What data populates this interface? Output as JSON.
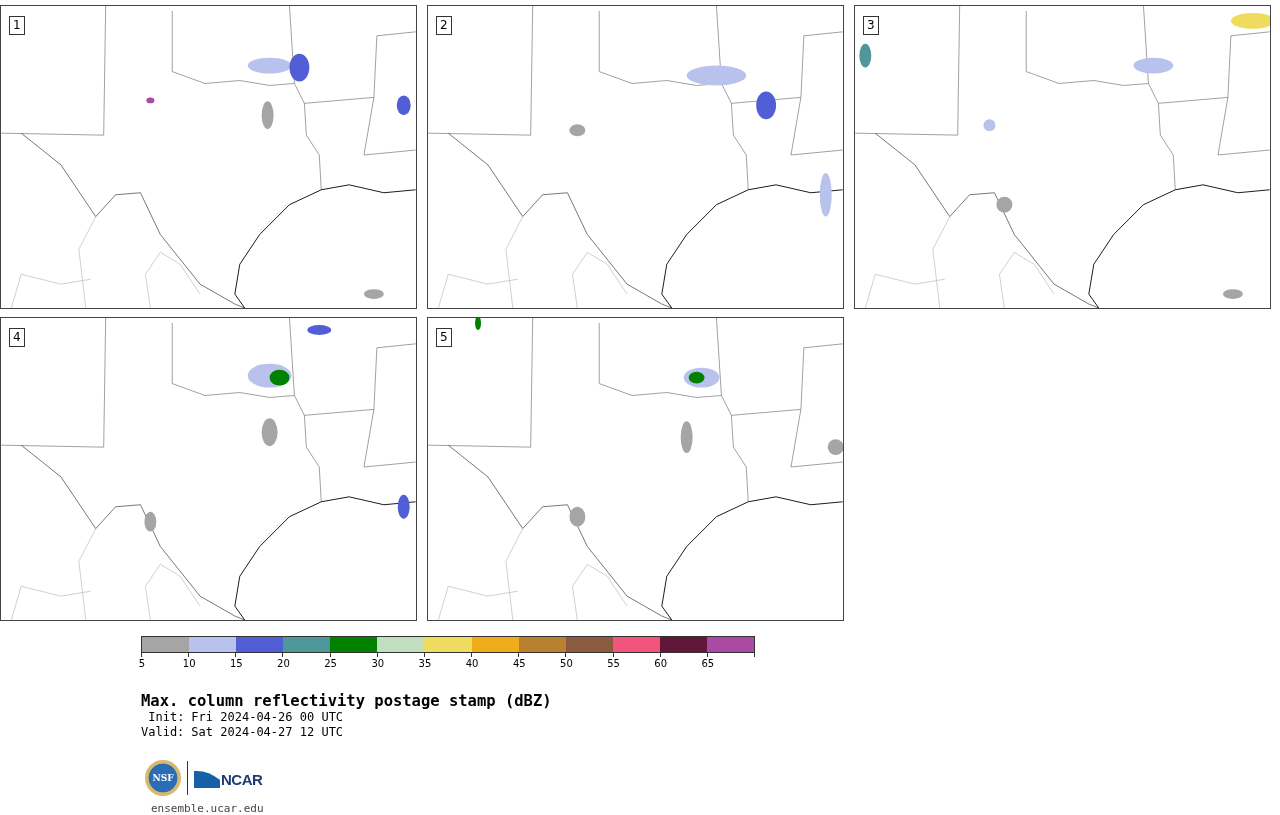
{
  "panels": [
    {
      "label": "1"
    },
    {
      "label": "2"
    },
    {
      "label": "3"
    },
    {
      "label": "4"
    },
    {
      "label": "5"
    }
  ],
  "colorbar": {
    "segments": [
      {
        "color": "#a5a5a5"
      },
      {
        "color": "#b8c2ec"
      },
      {
        "color": "#525ed6"
      },
      {
        "color": "#4f979a"
      },
      {
        "color": "#008200"
      },
      {
        "color": "#bfdfbf"
      },
      {
        "color": "#efdb5d"
      },
      {
        "color": "#f0ac1a"
      },
      {
        "color": "#b9812f"
      },
      {
        "color": "#8a5b40"
      },
      {
        "color": "#f3547b"
      },
      {
        "color": "#621638"
      },
      {
        "color": "#ab4aa5"
      }
    ],
    "ticks": [
      "5",
      "10",
      "15",
      "20",
      "25",
      "30",
      "35",
      "40",
      "45",
      "50",
      "55",
      "60",
      "65"
    ]
  },
  "title": "Max. column reflectivity postage stamp (dBZ)",
  "info": [
    {
      "label": "Init:",
      "value": "Fri 2024-04-26 00 UTC"
    },
    {
      "label": "Valid:",
      "value": "Sat 2024-04-27 12 UTC"
    }
  ],
  "logos": {
    "nsf_text": "NSF",
    "ncar_text": "NCAR"
  },
  "url": "ensemble.ucar.edu"
}
